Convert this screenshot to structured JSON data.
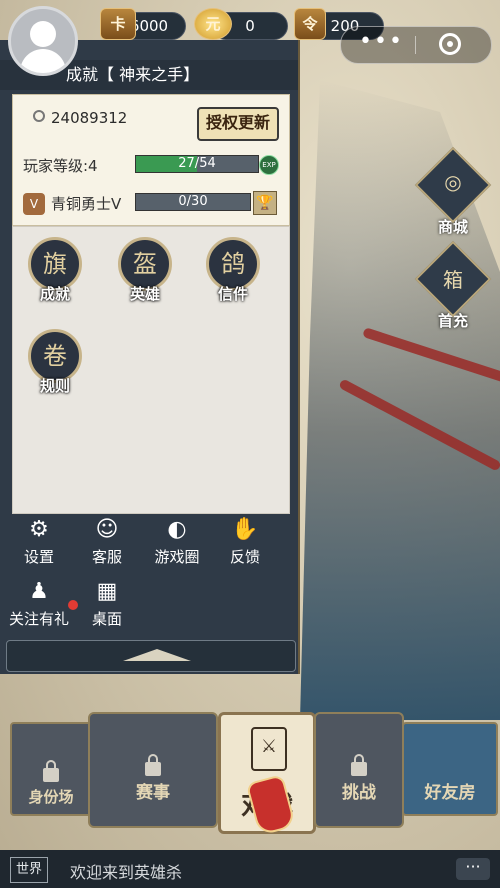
{
  "currencies": [
    {
      "name": "gold-card",
      "icon": "卡",
      "value": "6000"
    },
    {
      "name": "ingot",
      "icon": "元",
      "value": "0"
    },
    {
      "name": "medal",
      "icon": "令",
      "value": "200"
    }
  ],
  "capsule": {
    "more_icon": "•••",
    "close_icon": "target"
  },
  "profile": {
    "achievement_title": "成就【 神来之手】",
    "user_id": "24089312",
    "auth_button": "授权更新",
    "level_label": "玩家等级:4",
    "level_progress_text": "27/54",
    "level_progress_fraction": 0.5,
    "exp_badge": "EXP",
    "rank_badge": "V",
    "rank_label": "青铜勇士V",
    "rank_progress_text": "0/30",
    "rank_progress_fraction": 0.0,
    "trophy_icon": "🏆"
  },
  "features": [
    {
      "name": "achievement",
      "label": "成就",
      "glyph": "旗"
    },
    {
      "name": "hero",
      "label": "英雄",
      "glyph": "盔"
    },
    {
      "name": "letter",
      "label": "信件",
      "glyph": "鸽"
    },
    {
      "name": "rules",
      "label": "规则",
      "glyph": "卷"
    }
  ],
  "tools": [
    {
      "name": "settings",
      "label": "设置",
      "glyph": "⚙"
    },
    {
      "name": "customer-service",
      "label": "客服",
      "glyph": "☺"
    },
    {
      "name": "game-circle",
      "label": "游戏圈",
      "glyph": "◐"
    },
    {
      "name": "feedback",
      "label": "反馈",
      "glyph": "✋"
    },
    {
      "name": "follow-gift",
      "label": "关注有礼",
      "glyph": "♟"
    },
    {
      "name": "desktop",
      "label": "桌面",
      "glyph": "▦"
    }
  ],
  "side_buttons": [
    {
      "name": "shop",
      "label": "商城",
      "glyph": "◎"
    },
    {
      "name": "first-recharge",
      "label": "首充",
      "glyph": "箱"
    }
  ],
  "bottom_menu": {
    "identity": "身份场",
    "events": "赛事",
    "battle": "对战",
    "challenge": "挑战",
    "friend_room": "好友房"
  },
  "chat": {
    "channel": "世界",
    "message": "欢迎来到英雄杀",
    "more": "···"
  }
}
